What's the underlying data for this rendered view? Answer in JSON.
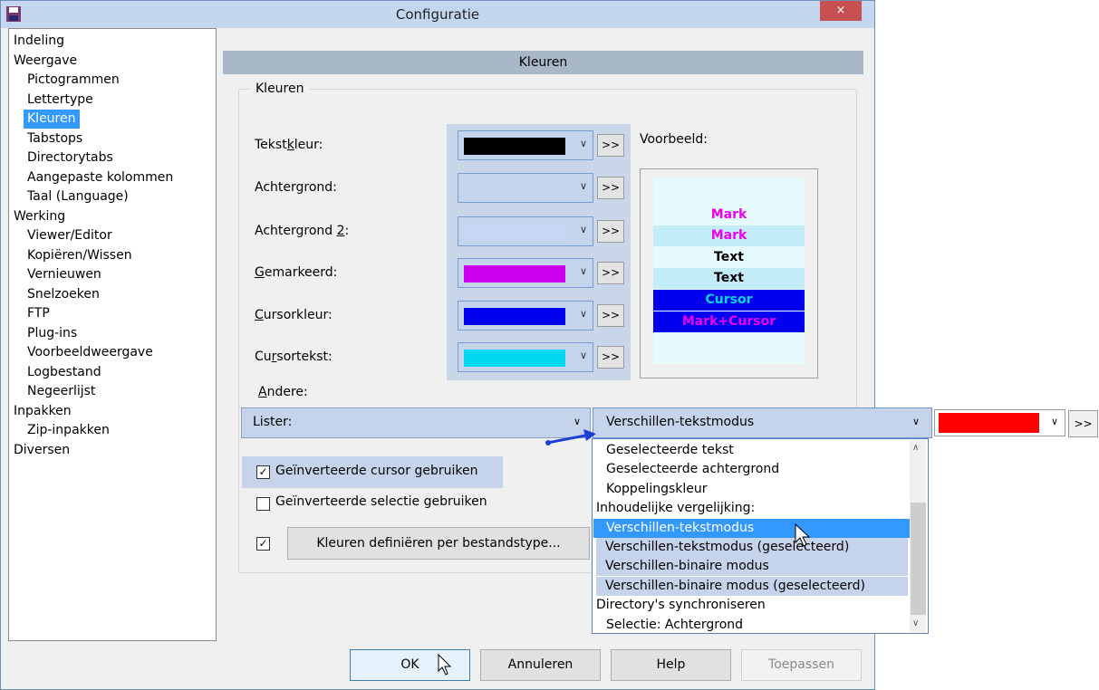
{
  "window": {
    "title": "Configuratie",
    "close_label": "×"
  },
  "tree": {
    "items": [
      {
        "label": "Indeling",
        "level": 0
      },
      {
        "label": "Weergave",
        "level": 0
      },
      {
        "label": "Pictogrammen",
        "level": 1
      },
      {
        "label": "Lettertype",
        "level": 1
      },
      {
        "label": "Kleuren",
        "level": 1,
        "selected": true
      },
      {
        "label": "Tabstops",
        "level": 1
      },
      {
        "label": "Directorytabs",
        "level": 1
      },
      {
        "label": "Aangepaste kolommen",
        "level": 1
      },
      {
        "label": "Taal (Language)",
        "level": 1
      },
      {
        "label": "Werking",
        "level": 0
      },
      {
        "label": "Viewer/Editor",
        "level": 1
      },
      {
        "label": "Kopiëren/Wissen",
        "level": 1
      },
      {
        "label": "Vernieuwen",
        "level": 1
      },
      {
        "label": "Snelzoeken",
        "level": 1
      },
      {
        "label": "FTP",
        "level": 1
      },
      {
        "label": "Plug-ins",
        "level": 1
      },
      {
        "label": "Voorbeeldweergave",
        "level": 1
      },
      {
        "label": "Logbestand",
        "level": 1
      },
      {
        "label": "Negeerlijst",
        "level": 1
      },
      {
        "label": "Inpakken",
        "level": 0
      },
      {
        "label": "Zip-inpakken",
        "level": 1
      },
      {
        "label": "Diversen",
        "level": 0
      }
    ]
  },
  "panel": {
    "header": "Kleuren",
    "group_label": "Kleuren",
    "preview_label": "Voorbeeld:",
    "more_label": ">>",
    "colors": [
      {
        "pre": "Tekst",
        "ul": "k",
        "post": "leur:",
        "swatch": "#000000"
      },
      {
        "pre": "Achtergrond:",
        "ul": "",
        "post": "",
        "swatch": ""
      },
      {
        "pre": "Achtergrond ",
        "ul": "2",
        "post": ":",
        "swatch": "#c9d6f3"
      },
      {
        "pre": "",
        "ul": "G",
        "post": "emarkeerd:",
        "swatch": "#cc00ee"
      },
      {
        "pre": "",
        "ul": "C",
        "post": "ursorkleur:",
        "swatch": "#0000ee"
      },
      {
        "pre": "Cu",
        "ul": "r",
        "post": "sortekst:",
        "swatch": "#00d9ee"
      }
    ],
    "preview_rows": [
      {
        "text": "Mark",
        "color": "#ee00ee",
        "bg": "#e6fbfc"
      },
      {
        "text": "Mark",
        "color": "#ee00ee",
        "bg": "#c3ecf9"
      },
      {
        "text": "Text",
        "color": "#000000",
        "bg": "#e6fbfc"
      },
      {
        "text": "Text",
        "color": "#000000",
        "bg": "#c3ecf9"
      },
      {
        "text": "Cursor",
        "color": "#00d9ee",
        "bg": "#0000ee"
      },
      {
        "text": "Mark+Cursor",
        "color": "#ee00ee",
        "bg": "#0000ee"
      }
    ],
    "andere_label": "Andere:",
    "lister_value": "Lister:",
    "mode_value": "Verschillen-tekstmodus",
    "mode_swatch": "#ff0000",
    "dropdown_items": [
      {
        "label": "Geselecteerde tekst",
        "indent": true,
        "state": "normal"
      },
      {
        "label": "Geselecteerde achtergrond",
        "indent": true,
        "state": "normal"
      },
      {
        "label": "Koppelingskleur",
        "indent": true,
        "state": "normal"
      },
      {
        "label": "Inhoudelijke vergelijking:",
        "indent": false,
        "state": "normal"
      },
      {
        "label": "Verschillen-tekstmodus",
        "indent": true,
        "state": "selected"
      },
      {
        "label": "Verschillen-tekstmodus (geselecteerd)",
        "indent": true,
        "state": "tinted"
      },
      {
        "label": "Verschillen-binaire modus",
        "indent": true,
        "state": "tinted"
      },
      {
        "label": "Verschillen-binaire modus (geselecteerd)",
        "indent": true,
        "state": "tinted"
      },
      {
        "label": "Directory's synchroniseren",
        "indent": false,
        "state": "normal"
      },
      {
        "label": "Selectie: Achtergrond",
        "indent": true,
        "state": "normal"
      }
    ],
    "check_inverted_cursor": {
      "label": "Geïnverteerde cursor gebruiken",
      "checked": true
    },
    "check_inverted_selection": {
      "label": "Geïnverteerde selectie gebruiken",
      "checked": false
    },
    "check_filetype": {
      "checked": true
    },
    "define_button": "Kleuren definiëren per bestandstype..."
  },
  "buttons": {
    "ok": "OK",
    "cancel": "Annuleren",
    "help": "Help",
    "apply": "Toepassen"
  }
}
